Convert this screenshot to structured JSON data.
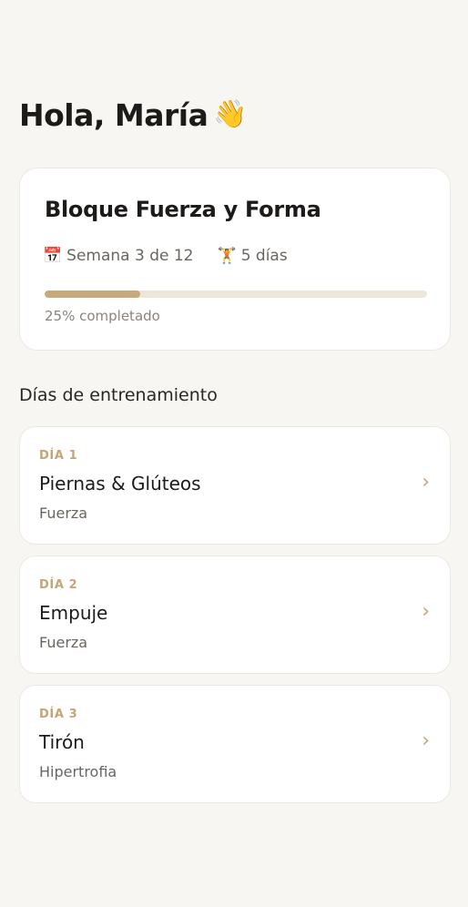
{
  "greeting": {
    "text": "Hola, María",
    "emoji": "👋"
  },
  "block": {
    "title": "Bloque Fuerza y Forma",
    "week_icon": "📅",
    "week_text": "Semana 3 de 12",
    "days_icon": "🏋️",
    "days_text": "5 días",
    "progress": 0.25,
    "progress_label": "25% completado",
    "accent_color": "#c7a97b",
    "track_color": "#ede6da"
  },
  "section": {
    "title": "Días de entrenamiento"
  },
  "days": [
    {
      "label": "DÍA 1",
      "name": "Piernas & Glúteos",
      "type": "Fuerza",
      "chevron": "›"
    },
    {
      "label": "DÍA 2",
      "name": "Empuje",
      "type": "Fuerza",
      "chevron": "›"
    },
    {
      "label": "DÍA 3",
      "name": "Tirón",
      "type": "Hipertrofia",
      "chevron": "›"
    }
  ]
}
